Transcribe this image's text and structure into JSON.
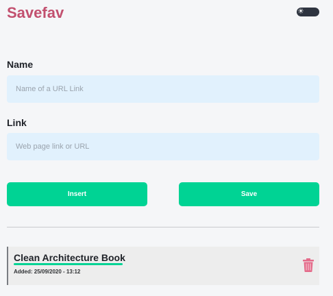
{
  "app": {
    "title": "Savefav"
  },
  "theme_toggle": {
    "icon": "sun-icon",
    "state": "dark"
  },
  "form": {
    "name": {
      "label": "Name",
      "placeholder": "Name of a URL Link",
      "value": ""
    },
    "link": {
      "label": "Link",
      "placeholder": "Web page link or URL",
      "value": ""
    },
    "insert_label": "Insert",
    "save_label": "Save"
  },
  "bookmarks": [
    {
      "title": "Clean Architecture Book",
      "added": "Added: 25/09/2020 - 13:12",
      "delete_icon": "trash-icon"
    }
  ],
  "colors": {
    "brand": "#c2506f",
    "accent": "#00d394",
    "input_bg": "#e1f1fd",
    "delete": "#e46b8a"
  }
}
